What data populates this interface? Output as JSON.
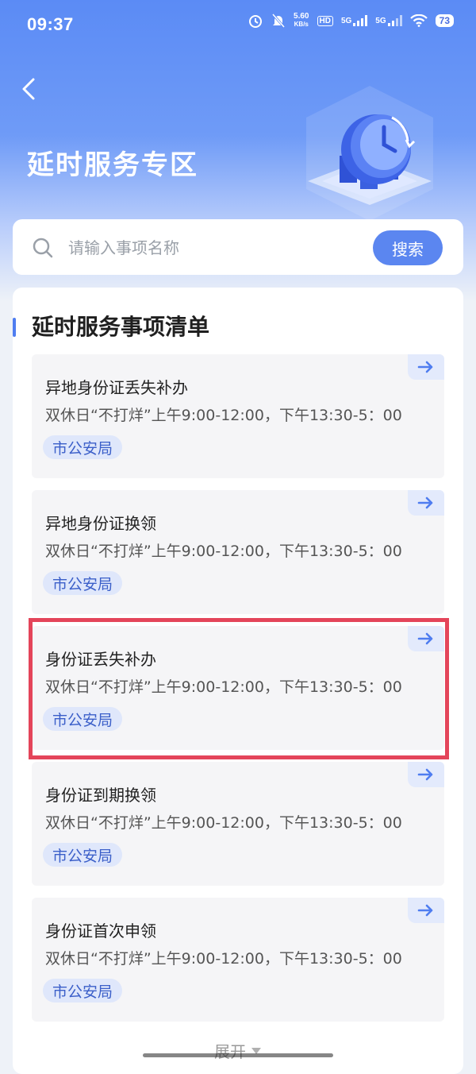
{
  "status_bar": {
    "time": "09:37",
    "net_speed_value": "5.60",
    "net_speed_unit": "KB/s",
    "hd": "HD",
    "sim1": "5G",
    "sim2": "5G",
    "battery": "73"
  },
  "header": {
    "title": "延时服务专区"
  },
  "search": {
    "placeholder": "请输入事项名称",
    "button_label": "搜索"
  },
  "list": {
    "title": "延时服务事项清单",
    "items": [
      {
        "title": "异地身份证丢失补办",
        "hours": "双休日“不打烊”上午9:00-12:00，下午13:30-5：00",
        "tag": "市公安局"
      },
      {
        "title": "异地身份证换领",
        "hours": "双休日“不打烊”上午9:00-12:00，下午13:30-5：00",
        "tag": "市公安局"
      },
      {
        "title": "身份证丢失补办",
        "hours": "双休日“不打烊”上午9:00-12:00，下午13:30-5：00",
        "tag": "市公安局"
      },
      {
        "title": "身份证到期换领",
        "hours": "双休日“不打烊”上午9:00-12:00，下午13:30-5：00",
        "tag": "市公安局"
      },
      {
        "title": "身份证首次申领",
        "hours": "双休日“不打烊”上午9:00-12:00，下午13:30-5：00",
        "tag": "市公安局"
      }
    ],
    "expand_label": "展开"
  },
  "colors": {
    "accent": "#5b86f0",
    "highlight": "#e4455a"
  }
}
